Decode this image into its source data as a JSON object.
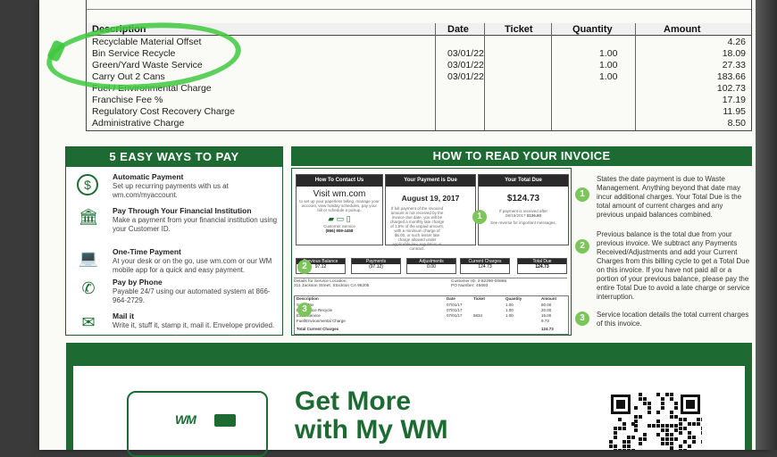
{
  "top_table": {
    "headers": [
      "Description",
      "Date",
      "Ticket",
      "Quantity",
      "Amount"
    ],
    "rows": [
      {
        "desc": "Recyclable Material Offset",
        "date": "",
        "ticket": "",
        "qty": "",
        "amount": "4.26"
      },
      {
        "desc": "Bin Service Recycle",
        "date": "03/01/22",
        "ticket": "",
        "qty": "1.00",
        "amount": "18.09"
      },
      {
        "desc": "Green/Yard Waste Service",
        "date": "03/01/22",
        "ticket": "",
        "qty": "1.00",
        "amount": "27.33"
      },
      {
        "desc": "Carry Out 2 Cans",
        "date": "03/01/22",
        "ticket": "",
        "qty": "1.00",
        "amount": "183.66"
      },
      {
        "desc": "Fuel / Environmental Charge",
        "date": "",
        "ticket": "",
        "qty": "",
        "amount": "102.73"
      },
      {
        "desc": "Franchise Fee %",
        "date": "",
        "ticket": "",
        "qty": "",
        "amount": "17.19"
      },
      {
        "desc": "Regulatory Cost Recovery Charge",
        "date": "",
        "ticket": "",
        "qty": "",
        "amount": "11.95"
      },
      {
        "desc": "Administrative Charge",
        "date": "",
        "ticket": "",
        "qty": "",
        "amount": "8.50"
      }
    ]
  },
  "pay": {
    "title": "5 EASY WAYS TO PAY",
    "items": [
      {
        "icon": "dollar-icon",
        "glyph": "$",
        "title": "Automatic Payment",
        "text": "Set up recurring payments with us at wm.com/myaccount."
      },
      {
        "icon": "bank-icon",
        "glyph": "🏛",
        "title": "Pay Through Your Financial Institution",
        "text": "Make a payment from your financial institution using your Customer ID."
      },
      {
        "icon": "laptop-icon",
        "glyph": "💻",
        "title": "One-Time Payment",
        "text": "At your desk or on the go, use wm.com or our WM mobile app for a quick and easy payment."
      },
      {
        "icon": "phone-icon",
        "glyph": "✆",
        "title": "Pay by Phone",
        "text": "Payable 24/7 using our automated system at 866-964-2729."
      },
      {
        "icon": "mail-icon",
        "glyph": "✉",
        "title": "Mail it",
        "text": "Write it, stuff it, stamp it, mail it. Envelope provided."
      }
    ]
  },
  "read": {
    "title": "HOW TO READ YOUR INVOICE",
    "contact_hdr": "How To Contact Us",
    "visit": "Visit wm.com",
    "contact_text": "to set up your paperless billing, manage your account, view holiday schedules, pay your bill or schedule a pickup.",
    "cs_label": "Customer Service",
    "cs_phone": "(866) 909-4458",
    "due_hdr": "Your Payment is Due",
    "due_date": "August 19, 2017",
    "due_text": "If full payment of the invoiced amount is not received by the invoice due date, you will be charged a monthly late charge of 1.5% of the unpaid amount, with a minimum charge of $5.00, or such lesser late charge allowed under applicable law, regulation or contract.",
    "total_hdr": "Your Total Due",
    "total": "$124.73",
    "total_after_label": "If payment is received after",
    "total_after_date": "08/19/2017",
    "total_after_amt": "$126.60",
    "total_note": "See reverse for important messages.",
    "summary": [
      {
        "h": "Previous Balance",
        "v": "97.12"
      },
      {
        "h": "Payments",
        "v": "(97.12)"
      },
      {
        "h": "Adjustments",
        "v": "0.00"
      },
      {
        "h": "Current Charges",
        "v": "124.73"
      },
      {
        "h": "Total Due",
        "v": "124.73"
      }
    ],
    "details_label": "Details for Service Location:",
    "details_addr": "311 Jackson Street, Stockton CA 95205",
    "customer_id_label": "Customer ID:",
    "customer_id": "2-82290-00885",
    "po_label": "PO Number:",
    "po": "45693",
    "mini_headers": [
      "Description",
      "Date",
      "Ticket",
      "Quantity",
      "Amount"
    ],
    "mini_rows": [
      {
        "d": "Sales Tax",
        "dt": "07/01/17",
        "t": "",
        "q": "1.00",
        "a": "80.00"
      },
      {
        "d": "Bin Service Recycle",
        "dt": "07/01/17",
        "t": "",
        "q": "1.00",
        "a": "20.00"
      },
      {
        "d": "Extra Service",
        "dt": "07/01/17",
        "t": "5934",
        "q": "1.00",
        "a": "15.00"
      },
      {
        "d": "Fuel/Environmental Charge",
        "dt": "",
        "t": "",
        "q": "",
        "a": "9.73"
      }
    ],
    "mini_total_label": "Total Current Charges",
    "mini_total": "124.73",
    "explanations": [
      {
        "n": "1",
        "text": "States the date payment is due to Waste Management. Anything beyond that date may incur additional charges. Your Total Due is the total amount of current charges and any previous unpaid balances combined."
      },
      {
        "n": "2",
        "text": "Previous balance is the total due from your previous invoice. We subtract any Payments Received/Adjustments and add your Current Charges from this billing cycle to get a Total Due on this invoice. If you have not paid all or a portion of your previous balance, please pay the entire Total Due to avoid a late charge or service interruption."
      },
      {
        "n": "3",
        "text": "Service location details the total current charges of this invoice."
      }
    ]
  },
  "banner": {
    "logo": "WM",
    "line1": "Get More",
    "line2": "with My WM"
  }
}
